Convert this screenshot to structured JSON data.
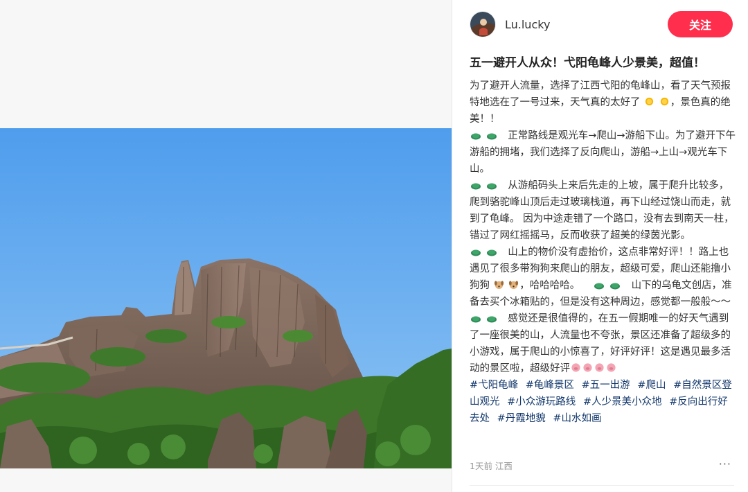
{
  "author": {
    "name": "Lu.lucky",
    "follow_label": "关注"
  },
  "note": {
    "title": "五一避开人从众！弋阳龟峰人少景美，超值！",
    "p1_a": "为了避开人流量，选择了江西弋阳的龟峰山，看了天气预报特地选在了一号过来，天气真的太好了",
    "p1_b": "，景色真的绝美！！",
    "p2": "正常路线是观光车→爬山→游船下山。为了避开下午游船的拥堵，我们选择了反向爬山，游船→上山→观光车下山。",
    "p3": "从游船码头上来后先走的上坡，属于爬升比较多，爬到骆驼峰山顶后走过玻璃栈道，再下山经过饶山而走，就到了龟峰。  因为中途走错了一个路口，没有去到南天一柱，错过了网红摇摇马，反而收获了超美的绿茵光影。",
    "p4_a": "山上的物价没有虚抬价，这点非常好评！！路上也遇见了很多带狗狗来爬山的朋友，超级可爱，爬山还能撸小狗狗",
    "p4_b": "，哈哈哈哈。",
    "p4_c": "山下的乌龟文创店，准备去买个冰箱贴的，但是没有这种周边，感觉都一般般～～",
    "p5": "感觉还是很值得的，在五一假期唯一的好天气遇到了一座很美的山，人流量也不夸张，景区还准备了超级多的小游戏，属于爬山的小惊喜了，好评好评！这是遇见最多活动的景区啦，超级好评",
    "tags": [
      "#弋阳龟峰",
      "#龟峰景区",
      "#五一出游",
      "#爬山",
      "#自然景区登山观光",
      "#小众游玩路线",
      "#人少景美小众地",
      "#反向出行好去处",
      "#丹霞地貌",
      "#山水如画"
    ]
  },
  "meta": {
    "time_location": "1天前 江西",
    "more_label": "···"
  },
  "icons": {
    "turtle": "turtle-emoji-icon",
    "sun": "sun-emoji-icon",
    "dog": "dog-emoji-icon",
    "pig": "pig-emoji-icon"
  },
  "colors": {
    "accent": "#ff2e4d",
    "tag": "#13386c",
    "sky": "#5ea8ee"
  }
}
